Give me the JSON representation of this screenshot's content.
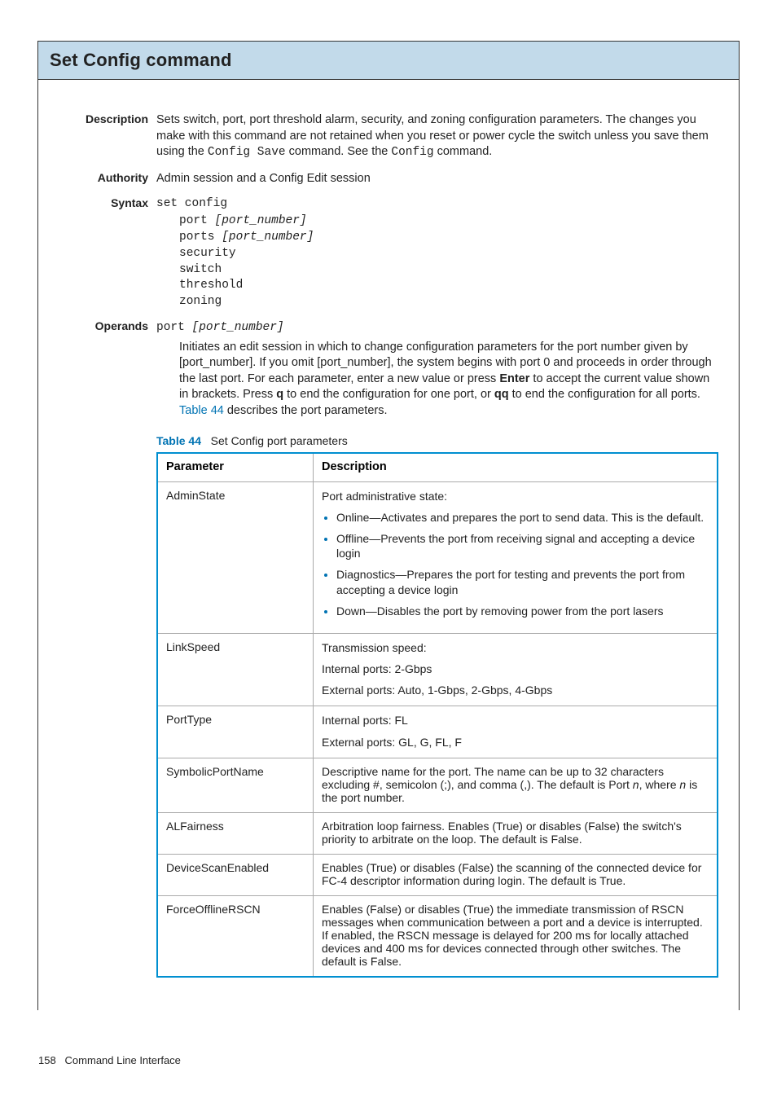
{
  "title": "Set Config command",
  "description": {
    "label": "Description",
    "text_pre": "Sets switch, port, port threshold alarm, security, and zoning configuration parameters. The changes you make with this command are not retained when you reset or power cycle the switch unless you save them using the ",
    "code1": "Config Save",
    "mid": " command. See the ",
    "code2": "Config",
    "post": " command."
  },
  "authority": {
    "label": "Authority",
    "text": "Admin session and a Config Edit session"
  },
  "syntax": {
    "label": "Syntax",
    "cmd": "set config",
    "lines": {
      "l1a": "port ",
      "l1b": "[port_number]",
      "l2a": "ports ",
      "l2b": "[port_number]",
      "l3": "security",
      "l4": "switch",
      "l5": "threshold",
      "l6": "zoning"
    }
  },
  "operands": {
    "label": "Operands",
    "cmd": "port ",
    "arg": "[port_number]",
    "desc_pre": "Initiates an edit session in which to change configuration parameters for the port number given by [port_number]. If you omit [port_number], the system begins with port 0 and proceeds in order through the last port. For each parameter, enter a new value or press ",
    "enter": "Enter",
    "mid1": " to accept the current value shown in brackets. Press ",
    "q": "q",
    "mid2": " to end the configuration for one port, or ",
    "qq": "qq",
    "mid3": " to end the configuration for all ports. ",
    "tref": "Table 44",
    "post": " describes the port parameters."
  },
  "table": {
    "caption_num": "Table 44",
    "caption_text": "Set Config port parameters",
    "h1": "Parameter",
    "h2": "Description",
    "rows": {
      "r1": {
        "param": "AdminState",
        "lead": "Port administrative state:",
        "b1": "Online—Activates and prepares the port to send data. This is the default.",
        "b2": "Offline—Prevents the port from receiving signal and accepting a device login",
        "b3": "Diagnostics—Prepares the port for testing and prevents the port from accepting a device login",
        "b4": "Down—Disables the port by removing power from the port lasers"
      },
      "r2": {
        "param": "LinkSpeed",
        "p1": "Transmission speed:",
        "p2": "Internal ports: 2-Gbps",
        "p3": "External ports: Auto, 1-Gbps, 2-Gbps, 4-Gbps"
      },
      "r3": {
        "param": "PortType",
        "p1": "Internal ports: FL",
        "p2": "External ports: GL, G, FL, F"
      },
      "r4": {
        "param": "SymbolicPortName",
        "pre": "Descriptive name for the port. The name can be up to 32 characters excluding #, semicolon (;), and comma (,). The default is Port ",
        "n1": "n",
        "mid": ", where ",
        "n2": "n",
        "post": " is the port number."
      },
      "r5": {
        "param": "ALFairness",
        "text": "Arbitration loop fairness. Enables (True) or disables (False) the switch's priority to arbitrate on the loop. The default is False."
      },
      "r6": {
        "param": "DeviceScanEnabled",
        "text": "Enables (True) or disables (False) the scanning of the connected device for FC-4 descriptor information during login. The default is True."
      },
      "r7": {
        "param": "ForceOfflineRSCN",
        "text": "Enables (False) or disables (True) the immediate transmission of RSCN messages when communication between a port and a device is interrupted. If enabled, the RSCN message is delayed for 200 ms for locally attached devices and 400 ms for devices connected through other switches. The default is False."
      }
    }
  },
  "footer": {
    "page": "158",
    "section": "Command Line Interface"
  }
}
